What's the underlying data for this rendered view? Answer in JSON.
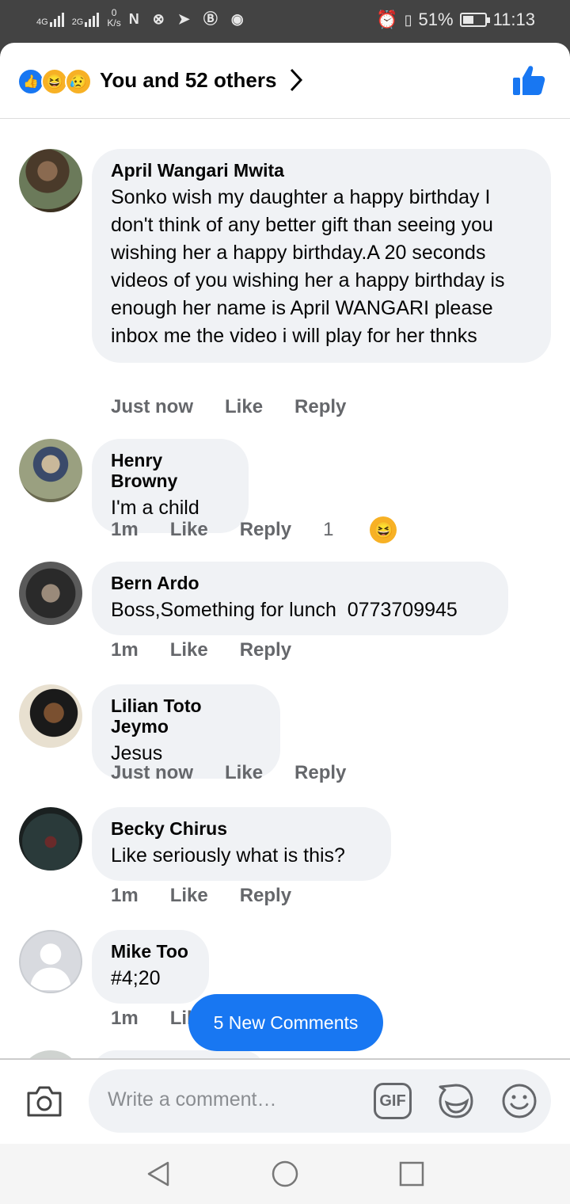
{
  "status": {
    "net1": "4G",
    "net2": "2G",
    "speed": "0\nK/s",
    "battery": "51%",
    "time": "11:13",
    "battery_level": 0.51
  },
  "header": {
    "title": "You and 52 others",
    "reactions": [
      "like-icon",
      "haha-icon",
      "sad-icon"
    ]
  },
  "comments": [
    {
      "name": "April Wangari Mwita",
      "text": "Sonko wish my daughter a happy birthday I don't think of any better gift than seeing you wishing her a happy birthday.A 20 seconds videos of you wishing her a happy birthday is enough her name is April WANGARI please inbox me the video i will play for her thnks",
      "time": "Just now",
      "like": "Like",
      "reply": "Reply"
    },
    {
      "name": "Henry Browny",
      "text": "I'm a child",
      "time": "1m",
      "like": "Like",
      "reply": "Reply",
      "reaction_count": "1"
    },
    {
      "name": "Bern Ardo",
      "text": "Boss,Something for lunch  0773709945",
      "time": "1m",
      "like": "Like",
      "reply": "Reply"
    },
    {
      "name": "Lilian Toto Jeymo",
      "text": "Jesus",
      "time": "Just now",
      "like": "Like",
      "reply": "Reply"
    },
    {
      "name": "Becky Chirus",
      "text": "Like seriously what is this?",
      "time": "1m",
      "like": "Like",
      "reply": "Reply"
    },
    {
      "name": "Mike Too",
      "text": "#4;20",
      "time": "1m",
      "like": "Lil",
      "reply": ""
    }
  ],
  "new_comments": "5 New Comments",
  "composer": {
    "placeholder": "Write a comment…",
    "gif": "GIF"
  },
  "colors": {
    "accent": "#1877f2",
    "bubble": "#f0f2f5",
    "muted": "#65676b"
  }
}
